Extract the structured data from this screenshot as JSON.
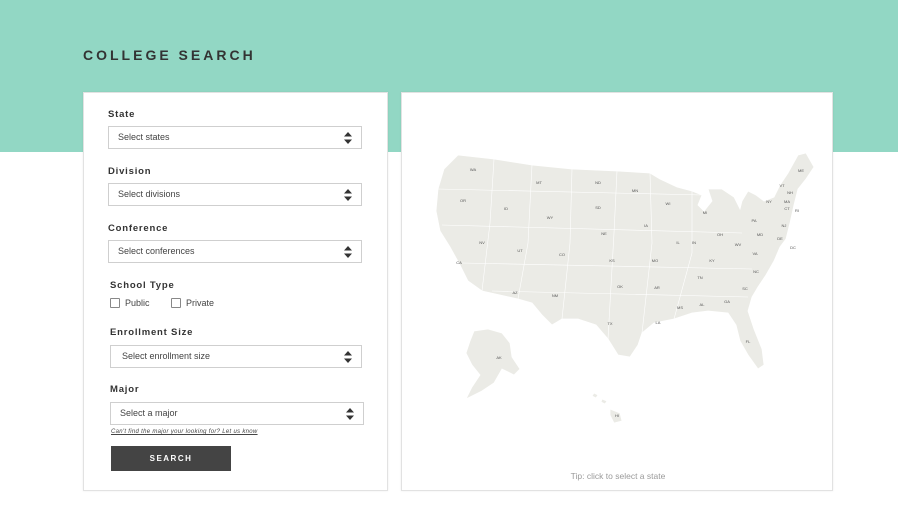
{
  "header": {
    "title": "COLLEGE SEARCH"
  },
  "colors": {
    "banner": "#92d7c4",
    "button": "#444444",
    "map_land": "#ebebe6"
  },
  "filters": {
    "state": {
      "label": "State",
      "value": "Select states"
    },
    "division": {
      "label": "Division",
      "value": "Select divisions"
    },
    "conference": {
      "label": "Conference",
      "value": "Select conferences"
    },
    "school_type": {
      "label": "School Type",
      "options": [
        "Public",
        "Private"
      ]
    },
    "enrollment": {
      "label": "Enrollment Size",
      "value": "Select enrollment size"
    },
    "major": {
      "label": "Major",
      "value": "Select a major"
    },
    "help_link": "Can't find the major your looking for? Let us know",
    "search_label": "SEARCH"
  },
  "map": {
    "tip": "Tip: click to select a state",
    "states": [
      "WA",
      "MT",
      "ND",
      "MN",
      "ME",
      "OR",
      "ID",
      "SD",
      "WI",
      "VT",
      "NH",
      "MI",
      "NY",
      "MA",
      "CT",
      "RI",
      "WY",
      "IA",
      "PA",
      "NJ",
      "NE",
      "IL",
      "IN",
      "OH",
      "MD",
      "DE",
      "DC",
      "NV",
      "UT",
      "CO",
      "WV",
      "VA",
      "KS",
      "MO",
      "KY",
      "CA",
      "NC",
      "TN",
      "OK",
      "AR",
      "SC",
      "AZ",
      "NM",
      "AL",
      "GA",
      "MS",
      "TX",
      "LA",
      "FL",
      "AK",
      "HI"
    ]
  }
}
